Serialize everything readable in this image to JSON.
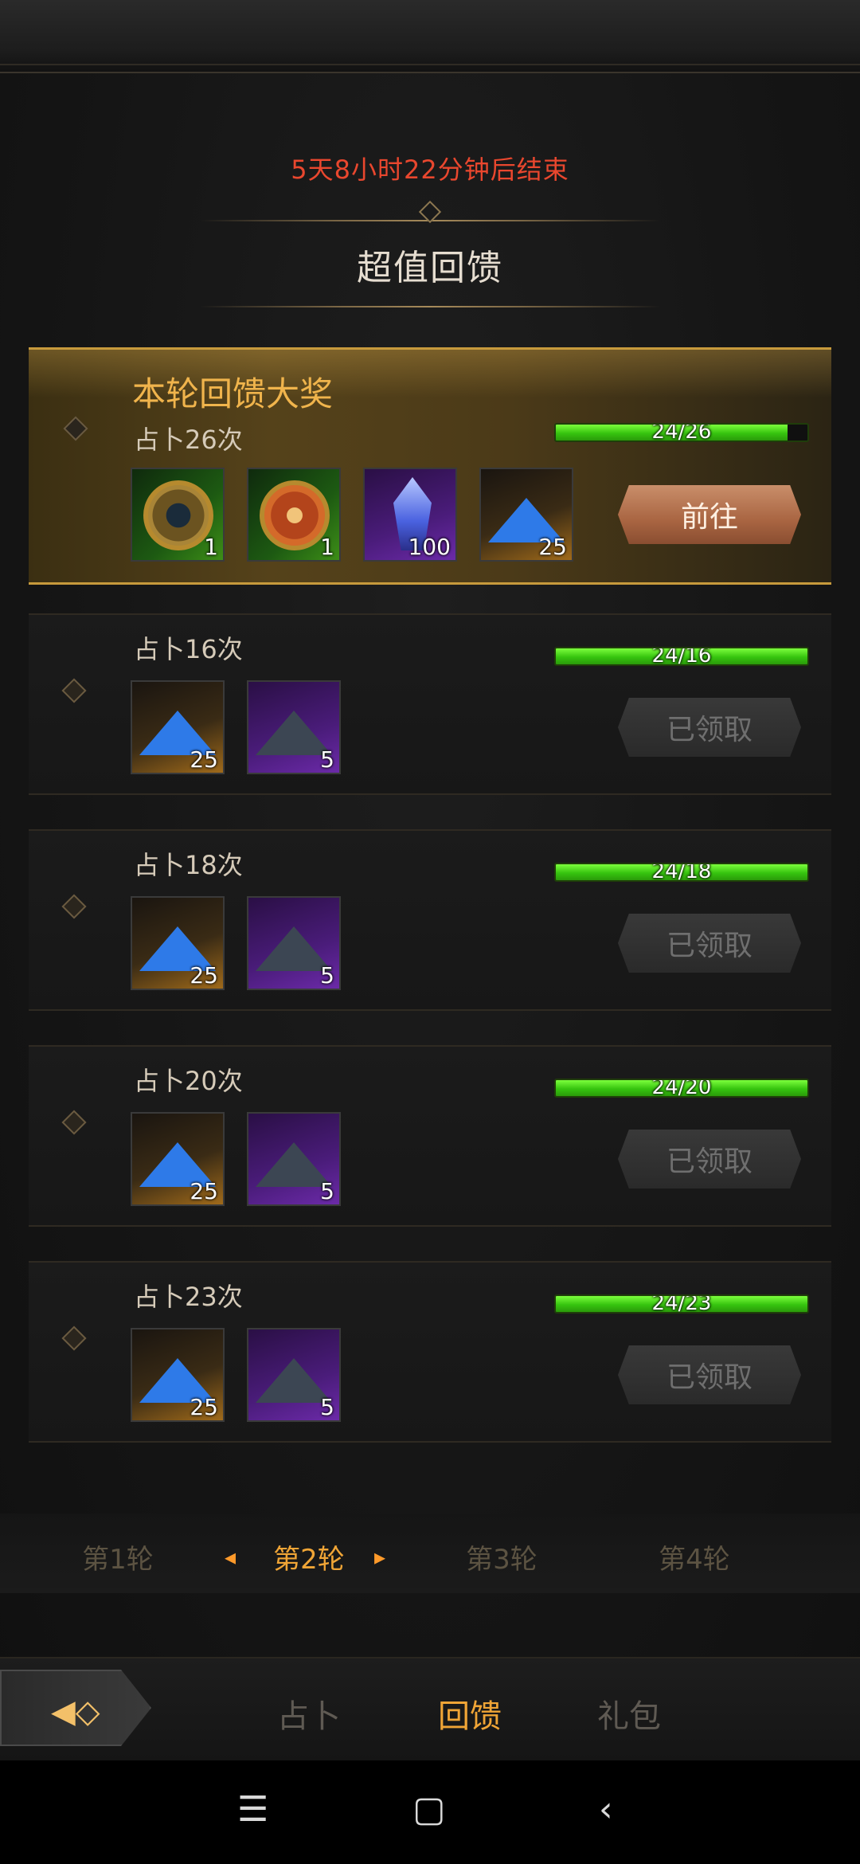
{
  "timer_text": "5天8小时22分钟后结束",
  "title": "超值回馈",
  "prize": {
    "title": "本轮回馈大奖",
    "condition": "占卜26次",
    "progress_text": "24/26",
    "progress": 0.92,
    "items": [
      {
        "icon": "compass-coin-icon",
        "count": "1"
      },
      {
        "icon": "red-coin-icon",
        "count": "1"
      },
      {
        "icon": "crystal-icon",
        "count": "100"
      },
      {
        "icon": "blue-pyramid-icon",
        "count": "25"
      }
    ],
    "button": "前往"
  },
  "rows": [
    {
      "condition": "占卜16次",
      "progress_text": "24/16",
      "items": [
        {
          "icon": "blue-pyramid-icon",
          "count": "25"
        },
        {
          "icon": "dark-pyramid-icon",
          "count": "5"
        }
      ],
      "button": "已领取"
    },
    {
      "condition": "占卜18次",
      "progress_text": "24/18",
      "items": [
        {
          "icon": "blue-pyramid-icon",
          "count": "25"
        },
        {
          "icon": "dark-pyramid-icon",
          "count": "5"
        }
      ],
      "button": "已领取"
    },
    {
      "condition": "占卜20次",
      "progress_text": "24/20",
      "items": [
        {
          "icon": "blue-pyramid-icon",
          "count": "25"
        },
        {
          "icon": "dark-pyramid-icon",
          "count": "5"
        }
      ],
      "button": "已领取"
    },
    {
      "condition": "占卜23次",
      "progress_text": "24/23",
      "items": [
        {
          "icon": "blue-pyramid-icon",
          "count": "25"
        },
        {
          "icon": "dark-pyramid-icon",
          "count": "5"
        }
      ],
      "button": "已领取"
    }
  ],
  "rounds": [
    "第1轮",
    "第2轮",
    "第3轮",
    "第4轮"
  ],
  "tabs": [
    "占卜",
    "回馈",
    "礼包"
  ],
  "colors": {
    "timer": "#e9472e",
    "accent": "#f0a536",
    "progress": "#36c40f"
  }
}
